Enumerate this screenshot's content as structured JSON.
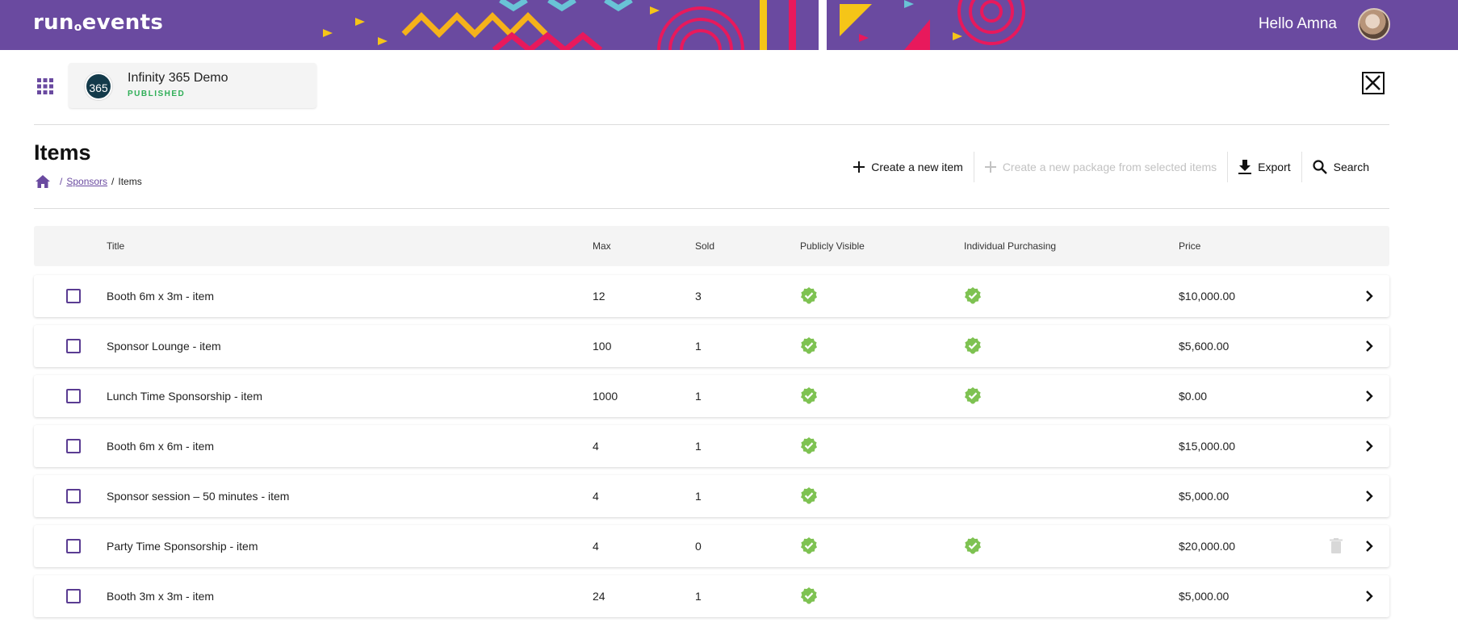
{
  "app": {
    "logo_main": "run",
    "logo_dot": "o",
    "logo_rest": "events",
    "greeting": "Hello Amna",
    "accent": "#6a4aa0"
  },
  "event": {
    "logo_text": "365",
    "title": "Infinity 365 Demo",
    "status": "PUBLISHED"
  },
  "page": {
    "title": "Items"
  },
  "breadcrumb": {
    "link": "Sponsors",
    "current": "Items"
  },
  "toolbar": {
    "create_item": "Create a new item",
    "create_package": "Create a new package from selected items",
    "export": "Export",
    "search": "Search"
  },
  "table": {
    "headers": {
      "title": "Title",
      "max": "Max",
      "sold": "Sold",
      "visible": "Publicly Visible",
      "individual": "Individual Purchasing",
      "price": "Price"
    },
    "rows": [
      {
        "title": "Booth 6m x 3m - item",
        "max": "12",
        "sold": "3",
        "visible": true,
        "individual": true,
        "price": "$10,000.00",
        "trash": false
      },
      {
        "title": "Sponsor Lounge - item",
        "max": "100",
        "sold": "1",
        "visible": true,
        "individual": true,
        "price": "$5,600.00",
        "trash": false
      },
      {
        "title": "Lunch Time Sponsorship - item",
        "max": "1000",
        "sold": "1",
        "visible": true,
        "individual": true,
        "price": "$0.00",
        "trash": false
      },
      {
        "title": "Booth 6m x 6m - item",
        "max": "4",
        "sold": "1",
        "visible": true,
        "individual": false,
        "price": "$15,000.00",
        "trash": false
      },
      {
        "title": "Sponsor session – 50 minutes - item",
        "max": "4",
        "sold": "1",
        "visible": true,
        "individual": false,
        "price": "$5,000.00",
        "trash": false
      },
      {
        "title": "Party Time Sponsorship - item",
        "max": "4",
        "sold": "0",
        "visible": true,
        "individual": true,
        "price": "$20,000.00",
        "trash": true
      },
      {
        "title": "Booth 3m x 3m - item",
        "max": "24",
        "sold": "1",
        "visible": true,
        "individual": false,
        "price": "$5,000.00",
        "trash": false
      }
    ]
  }
}
